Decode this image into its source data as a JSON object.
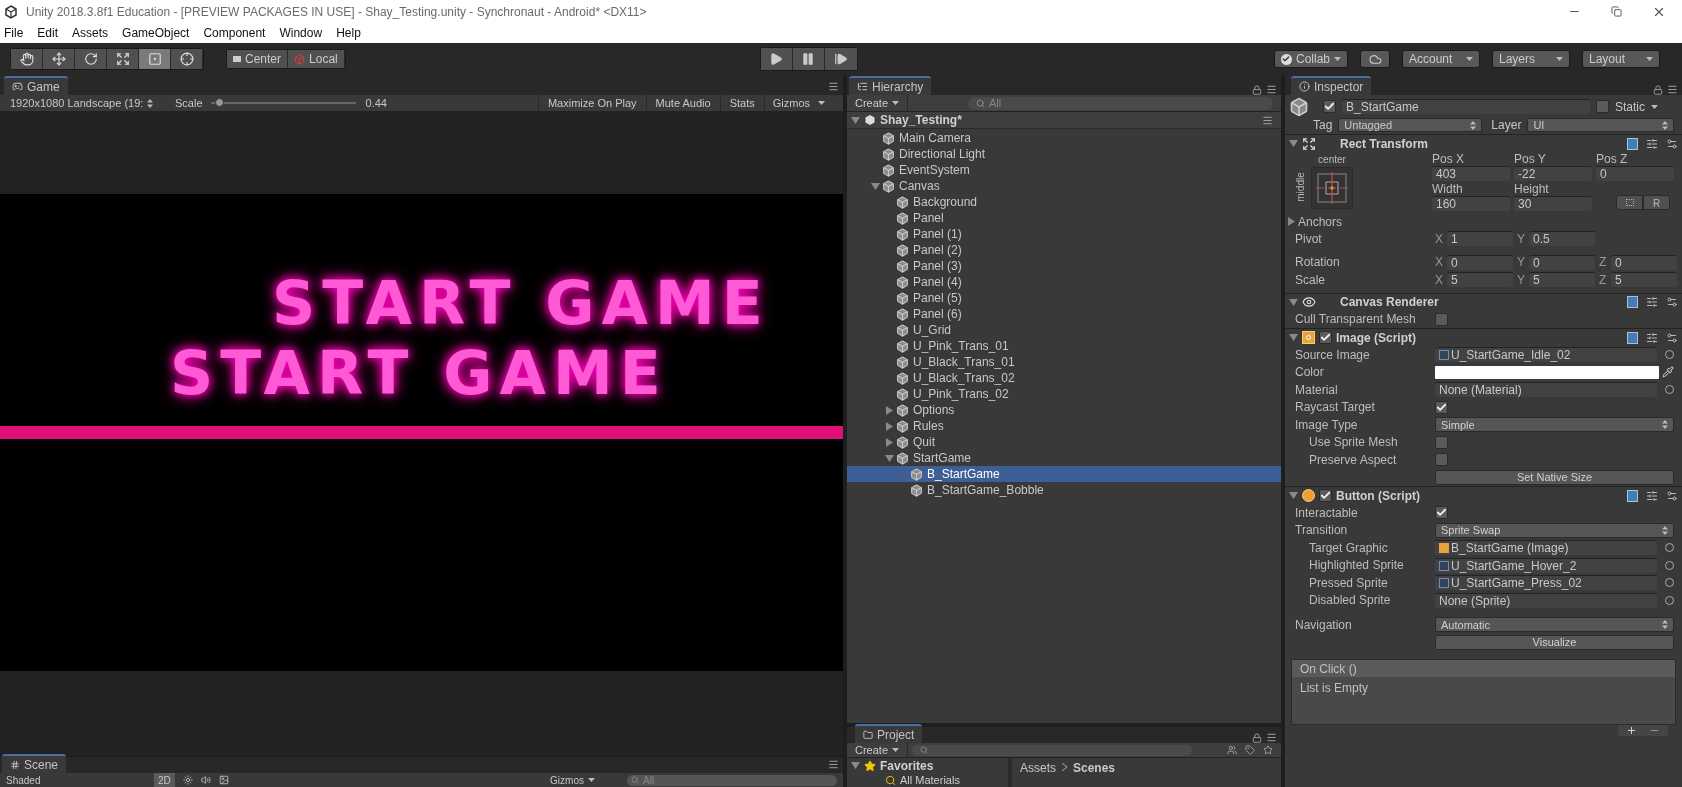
{
  "window": {
    "title": "Unity 2018.3.8f1 Education - [PREVIEW PACKAGES IN USE] - Shay_Testing.unity - Synchronaut - Android* <DX11>"
  },
  "menu": [
    "File",
    "Edit",
    "Assets",
    "GameObject",
    "Component",
    "Window",
    "Help"
  ],
  "tools": [
    {
      "kind": "hand",
      "selected": false
    },
    {
      "kind": "move",
      "selected": false
    },
    {
      "kind": "rotate",
      "selected": false
    },
    {
      "kind": "scale",
      "selected": false
    },
    {
      "kind": "rect",
      "selected": true
    },
    {
      "kind": "transform",
      "selected": false
    }
  ],
  "pivot_buttons": [
    "Center",
    "Local"
  ],
  "right_buttons": [
    {
      "kind": "collab",
      "label": "Collab"
    },
    {
      "kind": "cloud"
    },
    {
      "kind": "dropdown",
      "label": "Account"
    },
    {
      "kind": "dropdown",
      "label": "Layers"
    },
    {
      "kind": "dropdown",
      "label": "Layout"
    }
  ],
  "game": {
    "tab": "Game",
    "resolution": "1920x1080 Landscape (19:",
    "scale_label": "Scale",
    "scale": {
      "level": 0.03
    },
    "scale_value": "0.44",
    "toggles": [
      "Maximize On Play",
      "Mute Audio",
      "Stats"
    ],
    "gizmos": "Gizmos",
    "titles": [
      "START GAME",
      "START GAME"
    ]
  },
  "scene": {
    "tab": "Scene",
    "shading": "Shaded",
    "mode": "2D",
    "gizmos": "Gizmos",
    "search": {
      "placeholder": "All"
    }
  },
  "hierarchy": {
    "tab": "Hierarchy",
    "create": "Create",
    "search": {
      "placeholder": "All"
    },
    "scene": "Shay_Testing*",
    "items": [
      {
        "name": "Main Camera",
        "selected": false
      },
      {
        "name": "Directional Light",
        "selected": false
      },
      {
        "name": "EventSystem",
        "selected": false
      },
      {
        "name": "Canvas",
        "selected": false,
        "expanded": true,
        "children": [
          {
            "name": "Background",
            "selected": false
          },
          {
            "name": "Panel",
            "selected": false
          },
          {
            "name": "Panel (1)",
            "selected": false
          },
          {
            "name": "Panel (2)",
            "selected": false
          },
          {
            "name": "Panel (3)",
            "selected": false
          },
          {
            "name": "Panel (4)",
            "selected": false
          },
          {
            "name": "Panel (5)",
            "selected": false
          },
          {
            "name": "Panel (6)",
            "selected": false
          },
          {
            "name": "U_Grid",
            "selected": false
          },
          {
            "name": "U_Pink_Trans_01",
            "selected": false
          },
          {
            "name": "U_Black_Trans_01",
            "selected": false
          },
          {
            "name": "U_Black_Trans_02",
            "selected": false
          },
          {
            "name": "U_Pink_Trans_02",
            "selected": false
          },
          {
            "name": "Options",
            "selected": false,
            "expanded": false
          },
          {
            "name": "Rules",
            "selected": false,
            "expanded": false
          },
          {
            "name": "Quit",
            "selected": false,
            "expanded": false
          },
          {
            "name": "StartGame",
            "selected": false,
            "expanded": true,
            "children": [
              {
                "name": "B_StartGame",
                "selected": true
              },
              {
                "name": "B_StartGame_Bobble",
                "selected": false
              }
            ]
          }
        ]
      }
    ]
  },
  "project": {
    "tab": "Project",
    "create": "Create",
    "favorites": "Favorites",
    "items": [
      "All Materials"
    ],
    "breadcrumb": [
      "Assets",
      "Scenes"
    ]
  },
  "inspector": {
    "tab": "Inspector",
    "active": true,
    "name": "B_StartGame",
    "static_label": "Static",
    "static": false,
    "tag_label": "Tag",
    "tag": "Untagged",
    "layer_label": "Layer",
    "layer": "UI",
    "components": [
      {
        "kind": "rect_transform",
        "title": "Rect Transform",
        "anchor_h": "center",
        "anchor_v": "middle",
        "fields": [
          {
            "label": "Pos X",
            "value": "403"
          },
          {
            "label": "Pos Y",
            "value": "-22"
          },
          {
            "label": "Pos Z",
            "value": "0"
          },
          {
            "label": "Width",
            "value": "160"
          },
          {
            "label": "Height",
            "value": "30"
          }
        ],
        "raw_button": "R",
        "anchors": "Anchors",
        "vectors": [
          {
            "label": "Pivot",
            "values": [
              {
                "axis": "X",
                "value": "1"
              },
              {
                "axis": "Y",
                "value": "0.5"
              }
            ]
          },
          {
            "label": "Rotation",
            "values": [
              {
                "axis": "X",
                "value": "0"
              },
              {
                "axis": "Y",
                "value": "0"
              },
              {
                "axis": "Z",
                "value": "0"
              }
            ]
          },
          {
            "label": "Scale",
            "values": [
              {
                "axis": "X",
                "value": "5"
              },
              {
                "axis": "Y",
                "value": "5"
              },
              {
                "axis": "Z",
                "value": "5"
              }
            ]
          }
        ]
      },
      {
        "kind": "renderer",
        "title": "Canvas Renderer",
        "rows": [
          {
            "kind": "checkbox",
            "label": "Cull Transparent Mesh",
            "checked": false
          }
        ]
      },
      {
        "kind": "image",
        "enabled": true,
        "title": "Image (Script)",
        "rows": [
          {
            "kind": "sprite",
            "label": "Source Image",
            "value": "U_StartGame_Idle_02"
          },
          {
            "kind": "color",
            "label": "Color",
            "color": "#ffffff"
          },
          {
            "kind": "object",
            "label": "Material",
            "value": "None (Material)"
          },
          {
            "kind": "checkbox",
            "label": "Raycast Target",
            "checked": true
          },
          {
            "kind": "dropdown",
            "label": "Image Type",
            "value": "Simple"
          },
          {
            "kind": "checkbox",
            "label": "Use Sprite Mesh",
            "checked": false,
            "sub": true
          },
          {
            "kind": "checkbox",
            "label": "Preserve Aspect",
            "checked": false,
            "sub": true
          },
          {
            "kind": "button",
            "value": "Set Native Size"
          }
        ]
      },
      {
        "kind": "button",
        "enabled": true,
        "title": "Button (Script)",
        "rows": [
          {
            "kind": "checkbox",
            "label": "Interactable",
            "checked": true
          },
          {
            "kind": "dropdown",
            "label": "Transition",
            "value": "Sprite Swap"
          },
          {
            "kind": "graphic",
            "label": "Target Graphic",
            "value": "B_StartGame (Image)",
            "sub": true
          },
          {
            "kind": "sprite",
            "label": "Highlighted Sprite",
            "value": "U_StartGame_Hover_2",
            "sub": true
          },
          {
            "kind": "sprite",
            "label": "Pressed Sprite",
            "value": "U_StartGame_Press_02",
            "sub": true
          },
          {
            "kind": "object",
            "label": "Disabled Sprite",
            "value": "None (Sprite)",
            "sub": true
          },
          {
            "kind": "dropdown",
            "label": "Navigation",
            "value": "Automatic"
          },
          {
            "kind": "button",
            "value": "Visualize"
          },
          {
            "kind": "event",
            "title": "On Click ()",
            "value": "List is Empty"
          }
        ]
      }
    ]
  }
}
